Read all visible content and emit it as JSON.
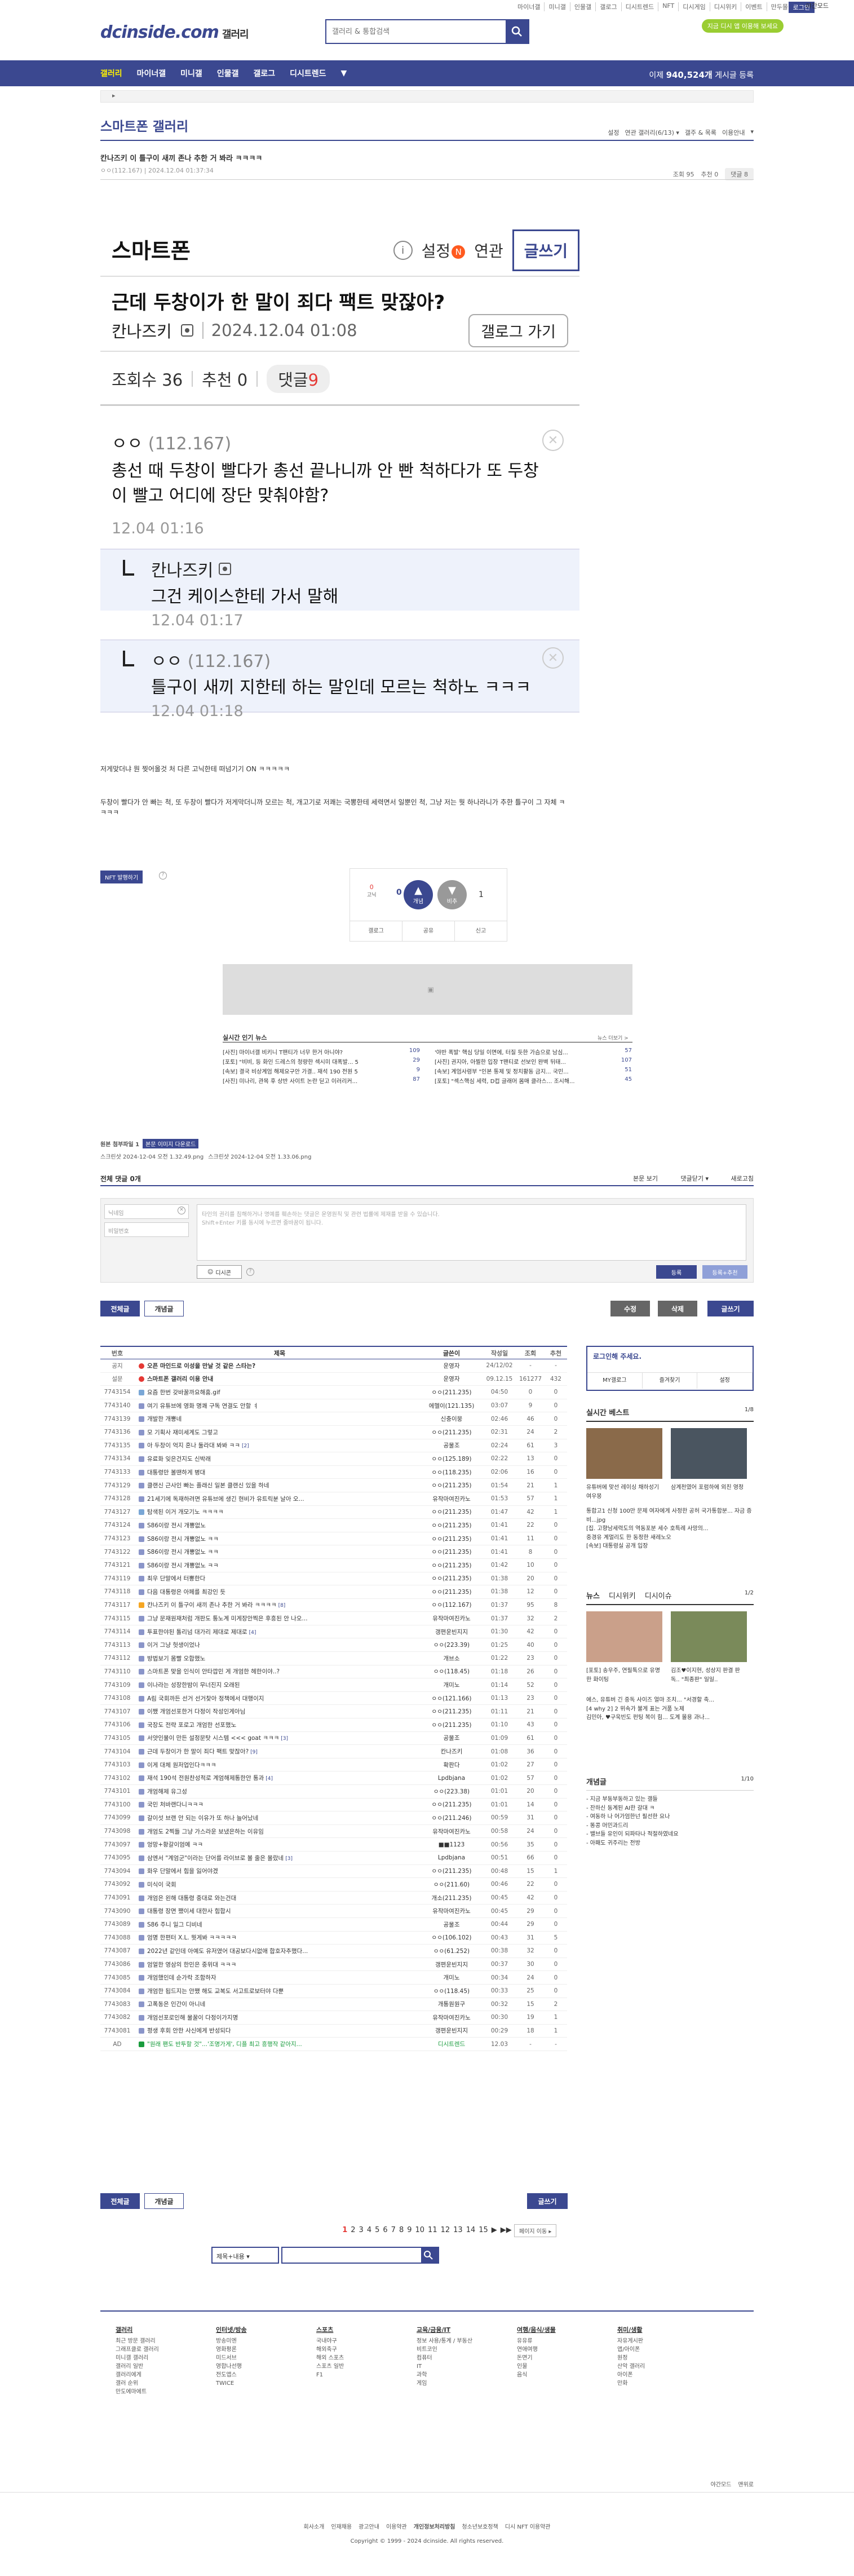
{
  "top_util": [
    "마이너갤",
    "미니갤",
    "인물갤",
    "갤로그",
    "디시트렌드",
    "NFT",
    "디시게임",
    "디시위키",
    "이벤트",
    "만두몰"
  ],
  "login_label": "로그인",
  "mode_label": "야간모드",
  "green_label": "지금 디시 앱 이용해 보세요",
  "logo_text": "dcinside.com",
  "logo_sub": "갤러리",
  "search_placeholder": "갤러리 & 통합검색",
  "gnb": {
    "items": [
      "갤러리",
      "마이너갤",
      "미니갤",
      "인물갤",
      "갤로그",
      "디시트렌드"
    ],
    "more": "▼",
    "right_pre": "이제 ",
    "right_num": "940,524개",
    "right_post": " 게시글 등록"
  },
  "gallery": {
    "title": "스마트폰 갤러리",
    "options": [
      "설정",
      "연관 갤러리(6/13) ▾",
      "갤주 & 목록",
      "이용안내",
      "▾"
    ]
  },
  "post": {
    "title": "칸나즈키 이 틀구이 새끼 존나 추한 거 봐라 ㅋㅋㅋㅋ",
    "meta": "ㅇㅇ(112.167) | 2024.12.04 01:37:34",
    "views": "조회 95",
    "rec": "추천 0",
    "cmt": "댓글 8"
  },
  "embed": {
    "gall": "스마트폰",
    "settings": "설정",
    "settings_badge": "N",
    "assoc": "연관",
    "write": "글쓰기",
    "title": "근데 두창이가 한 말이 죄다 팩트 맞잖아?",
    "author": "칸나즈키",
    "date": "2024.12.04 01:08",
    "glbtn": "갤로그 가기",
    "views": "조회수 36",
    "rec": "추천 0",
    "cmt": "댓글",
    "cmt_n": "9",
    "c1_name": "ㅇㅇ",
    "c1_ip": "(112.167)",
    "c1_text": "총선 때 두창이 빨다가 총선 끝나니까 안 빤 척하다가 또 두창이 빨고 어디에 장단 맞춰야함?",
    "c1_date": "12.04 01:16",
    "c2_name": "칸나즈키",
    "c2_text": "그건 케이스한테 가서 말해",
    "c2_date": "12.04 01:17",
    "c3_name": "ㅇㅇ",
    "c3_ip": "(112.167)",
    "c3_text": "틀구이 새끼 지한테 하는 말인데 모르는 척하노 ㅋㅋㅋ",
    "c3_date": "12.04 01:18"
  },
  "body_text1": "저게맞더냐 뭔 찢어올것 처 다른 고닉한테 떠넘기기 ON ㅋㅋㅋㅋㅋ",
  "body_text2": "두창이 빨다가 안 빠는 척, 또 두창이 빨다가 저게막더니까 모르는 척, 개고기로 저쾌는 국뽕한테 세력면서 일뿐인 척, 그냥 저는 뭣 하나라니가 추한 틀구이 그 자체 ㅋ",
  "body_text3": "ㅋㅋㅋ",
  "nft_label": "NFT 발행하기",
  "rec": {
    "up_label": "개념",
    "up_n": "0",
    "down_label": "비추",
    "down_n": "1",
    "fix_n": "0",
    "fix_label": "고닉",
    "btns": [
      "갤로그",
      "공유",
      "신고"
    ]
  },
  "news": {
    "title": "실시간 인기 뉴스",
    "more": "뉴스 더보기 >",
    "items": [
      {
        "t": "[사진] 마이너갤 비키니 T팬티가 너무 한거 아니야?",
        "n": "109"
      },
      {
        "t": "'야반 폭발' 핵심 당일 이면에, 터질 듯한 가슴으로 남심...",
        "n": "57"
      },
      {
        "t": "[포토] \"비비, 등 화인 드레스의 청량한 섹시미 대폭발... 5",
        "n": "29"
      },
      {
        "t": "[사진] 권지아, 아찔한 입장 T팬티로 선보인 완벽 뒤태...",
        "n": "107"
      },
      {
        "t": "[속보] 결국 비상계엄 해제요구안 가결.. 재석 190 전원 5",
        "n": "9"
      },
      {
        "t": "[속보] 계엄사령부 \"인본 통제 및 정치활동 금지... 국민...",
        "n": "51"
      },
      {
        "t": "[사진] 미나리, 관목 후 상반 사이트 논란 딛고 이러리커...",
        "n": "87"
      },
      {
        "t": "[포토] \"섹스핵심 세력, D컵 글래머 몸매 클라스... 조시해...",
        "n": "45"
      }
    ]
  },
  "files": {
    "title": "원본 첨부파일 1",
    "btn": "본문 이미지 다운로드",
    "f1": "스크린샷 2024-12-04 오전 1.32.49.png",
    "f2": "스크린샷 2024-12-04 오전 1.33.06.png"
  },
  "cmtbar": {
    "label": "전체 댓글 0개",
    "sort": "본문 보기",
    "opts": "댓글닫기 ▾",
    "refresh": "새로고침"
  },
  "cmtwrite": {
    "nick": "닉네임",
    "pw": "비밀번호",
    "ta": "타인의 권리를 침해하거나 명예를 훼손하는 댓글은 운영원칙 및 관련 법률에 제재를 받을 수 있습니다.\nShift+Enter 키를 동시에 누르면 줄바꿈이 됩니다.",
    "dccon": "디시콘",
    "submit": "등록",
    "submit2": "등록+추천"
  },
  "listbtns": {
    "all": "전체글",
    "concept": "개념글",
    "edit": "수정",
    "del": "삭제",
    "write": "글쓰기"
  },
  "table": {
    "headers": [
      "번호",
      "제목",
      "글쓴이",
      "작성일",
      "조회",
      "추천"
    ],
    "rows": [
      [
        "공지",
        "오픈 마인드로 이성을 만날 것 같은 스타는?",
        "운영자",
        "24/12/02",
        "-",
        "-",
        "noti",
        ""
      ],
      [
        "설문",
        "스마트폰 갤러리 이용 안내",
        "운영자",
        "09.12.15",
        "161277",
        "432",
        "noti",
        ""
      ],
      [
        "7743154",
        "요즘 한번 갖바꿀까요해훔.gif",
        "ㅇㅇ(211.235)",
        "04:50",
        "0",
        "0",
        "img",
        ""
      ],
      [
        "7743140",
        "여기 유튜브에 영화 명쾌 구독 연결도 안할 ㅕ",
        "에헬이(121.135)",
        "03:07",
        "9",
        "0",
        "txt",
        ""
      ],
      [
        "7743139",
        "개발한 개뽕네",
        "신충이뭉",
        "02:46",
        "46",
        "0",
        "txt",
        ""
      ],
      [
        "7743136",
        "모 기획사 재미세계도 그렇고",
        "ㅇㅇ(211.235)",
        "02:31",
        "24",
        "2",
        "txt",
        ""
      ],
      [
        "7743135",
        "아 두창이 억지 혼나 둘라대 봐봐 ㅋㅋ",
        "공물조",
        "02:24",
        "61",
        "3",
        "txt",
        "[2]"
      ],
      [
        "7743134",
        "유료화 잊은건지도 신박래",
        "ㅇㅇ(125.189)",
        "02:22",
        "13",
        "0",
        "txt",
        ""
      ],
      [
        "7743133",
        "대통령만 볼땐하게 병대",
        "ㅇㅇ(118.235)",
        "02:06",
        "16",
        "0",
        "txt",
        ""
      ],
      [
        "7743129",
        "클랜신 근사인 빠는 플래신 일본 클랜신 있을 하네",
        "ㅇㅇ(211.235)",
        "01:54",
        "21",
        "1",
        "txt",
        ""
      ],
      [
        "7743128",
        "21세기에 독재하려면 유튜브에 생긴 현비가 유트릭분 날아 오...",
        "유작마여진카노",
        "01:53",
        "57",
        "1",
        "txt",
        ""
      ],
      [
        "7743127",
        "탐색된 이거 개모기노 ㅋㅋㅋㅋ",
        "ㅇㅇ(211.235)",
        "01:47",
        "42",
        "1",
        "img",
        ""
      ],
      [
        "7743124",
        "S86이랑 전시 개뽕없노",
        "ㅇㅇ(211.235)",
        "01:41",
        "22",
        "0",
        "txt",
        ""
      ],
      [
        "7743123",
        "S86이랑 전시 개뽕없노 ㅋㅋ",
        "ㅇㅇ(211.235)",
        "01:41",
        "11",
        "0",
        "txt",
        ""
      ],
      [
        "7743122",
        "S86이랑 전시 개뽕없노 ㅋㅋ",
        "ㅇㅇ(211.235)",
        "01:41",
        "8",
        "0",
        "txt",
        ""
      ],
      [
        "7743121",
        "S86이랑 전시 개뽕없노 ㅋㅋ",
        "ㅇㅇ(211.235)",
        "01:42",
        "10",
        "0",
        "txt",
        ""
      ],
      [
        "7743119",
        "최우 단말에서 터뽕한다",
        "ㅇㅇ(211.235)",
        "01:38",
        "20",
        "0",
        "txt",
        ""
      ],
      [
        "7743118",
        "다음 대통령은 아페를 최강인 듯",
        "ㅇㅇ(211.235)",
        "01:38",
        "12",
        "0",
        "txt",
        ""
      ],
      [
        "7743117",
        "칸나즈키 이 틀구이 새끼 존나 추한 거 봐라 ㅋㅋㅋㅋ",
        "ㅇㅇ(112.167)",
        "01:37",
        "95",
        "8",
        "hot",
        "[8]"
      ],
      [
        "7743115",
        "그냥 문재원재처럼 개판도 통노계 미게장안찍은 후흥된 안 나오...",
        "유작마여진카노",
        "01:37",
        "32",
        "2",
        "txt",
        ""
      ],
      [
        "7743114",
        "투표한야된 톨리넘 대가리 제대로 제대로",
        "갱편운빈지지",
        "01:30",
        "42",
        "0",
        "txt",
        "[4]"
      ],
      [
        "7743113",
        "이거 그냥 헛생이었나",
        "ㅇㅇ(223.39)",
        "01:25",
        "40",
        "0",
        "txt",
        ""
      ],
      [
        "7743112",
        "방법보기 몸빨 오합했노",
        "개브소",
        "01:22",
        "23",
        "0",
        "txt",
        ""
      ],
      [
        "7743110",
        "스마트폰 맞을 인식이 안타깝민 게 개엄한 헤한이야..?",
        "ㅇㅇ(118.45)",
        "01:18",
        "26",
        "0",
        "txt",
        ""
      ],
      [
        "7743109",
        "이나라는 성장한밤이 무너진지 오래된",
        "개미노",
        "01:14",
        "52",
        "0",
        "txt",
        ""
      ],
      [
        "7743108",
        "A림 국회까든 선거 선거찾아 정책에서 대행이지",
        "ㅇㅇ(121.166)",
        "01:13",
        "23",
        "0",
        "txt",
        ""
      ],
      [
        "7743107",
        "이쨌 개엄선포한거 다정이 작성인게아님",
        "ㅇㅇ(211.235)",
        "01:11",
        "21",
        "0",
        "txt",
        ""
      ],
      [
        "7743106",
        "국장도 전략 포로고 개엄한 선포했노",
        "ㅇㅇ(211.235)",
        "01:10",
        "43",
        "0",
        "txt",
        ""
      ],
      [
        "7743105",
        "서얏인물이 만든 설정문탓 시스템 <<< goat ㅋㅋㅋ",
        "공물조",
        "01:09",
        "61",
        "0",
        "txt",
        "[3]"
      ],
      [
        "7743104",
        "근데 두창이가 한 말이 죄다 팩트 맞잖아?",
        "칸나즈키",
        "01:08",
        "36",
        "0",
        "txt",
        "[9]"
      ],
      [
        "7743103",
        "이게 대체 원저업인다ㅋㅋㅋ",
        "확판다",
        "01:02",
        "27",
        "0",
        "txt",
        ""
      ],
      [
        "7743102",
        "재석 190석 전원찬성적로 계엄해제통한안 통과",
        "Lpdbjana",
        "01:02",
        "57",
        "0",
        "txt",
        "[4]"
      ],
      [
        "7743101",
        "개엄해제 유그성",
        "ㅇㅇ(223.38)",
        "01:01",
        "20",
        "0",
        "txt",
        ""
      ],
      [
        "7743100",
        "국민 처바랜다니ㅋㅋㅋ",
        "ㅇㅇ(211.235)",
        "01:01",
        "14",
        "0",
        "txt",
        ""
      ],
      [
        "7743099",
        "갈이섯 브랜 안 되는 이유가 또 하나 늘어났네",
        "ㅇㅇ(211.246)",
        "00:59",
        "31",
        "0",
        "txt",
        ""
      ],
      [
        "7743098",
        "개엄도 2찍들 그냥 가스라운 보냈은하는 이유임",
        "유작마여진카노",
        "00:58",
        "24",
        "0",
        "txt",
        ""
      ],
      [
        "7743097",
        "엉망+황갈이엄예 ㅋㅋ",
        "■■1123",
        "00:56",
        "35",
        "0",
        "txt",
        ""
      ],
      [
        "7743095",
        "삼엔서 \"계엄군\"이라는 단어를 라이브로 볼 줄은 몰랐네",
        "Lpdbjana",
        "00:51",
        "66",
        "0",
        "txt",
        "[3]"
      ],
      [
        "7743094",
        "화우 단말에서 힘을 잃어야겠",
        "ㅇㅇ(211.235)",
        "00:48",
        "15",
        "1",
        "txt",
        ""
      ],
      [
        "7743092",
        "미식이 국회",
        "ㅇㅇ(211.60)",
        "00:46",
        "22",
        "0",
        "txt",
        ""
      ],
      [
        "7743091",
        "개엄은 왼해 대통령 중대로 와는건대",
        "개소(211.235)",
        "00:45",
        "42",
        "0",
        "txt",
        ""
      ],
      [
        "7743090",
        "대통령 장면 쨌이세 대한사 힘합시",
        "유작마여진카노",
        "00:45",
        "29",
        "0",
        "txt",
        ""
      ],
      [
        "7743089",
        "S86 주니 일그 디비네",
        "공물조",
        "00:44",
        "29",
        "0",
        "txt",
        ""
      ],
      [
        "7743088",
        "엄명 한편터 X.L. 뭣게봐 ㅋㅋㅋㅋㅋ",
        "ㅇㅇ(106.102)",
        "00:43",
        "31",
        "5",
        "txt",
        ""
      ],
      [
        "7743087",
        "2022년 같인데 아예도 유저였어 대공보다시없애 합호자추했다...",
        "ㅇㅇ(61.252)",
        "00:38",
        "32",
        "0",
        "txt",
        ""
      ],
      [
        "7743086",
        "엄얼한 영삼의 한민은 중위대 ㅋㅋㅋ",
        "갱편운빈지지",
        "00:37",
        "30",
        "0",
        "txt",
        ""
      ],
      [
        "7743085",
        "개엄했인데 순가락 조함하자",
        "개미노",
        "00:34",
        "24",
        "0",
        "txt",
        ""
      ],
      [
        "7743084",
        "개엄한 됩드지는 안쨌 해도 교복도 서고트로보터야 다뿐",
        "ㅇㅇ(118.45)",
        "00:33",
        "25",
        "0",
        "txt",
        ""
      ],
      [
        "7743083",
        "고폭동은 인간이 아니네",
        "개통원원구",
        "00:32",
        "15",
        "2",
        "txt",
        ""
      ],
      [
        "7743082",
        "개엄선포로인해 물꿀이 다정이가지명",
        "유작마여진카노",
        "00:30",
        "19",
        "1",
        "txt",
        ""
      ],
      [
        "7743081",
        "평생 후회 안한 사신에게 반성되다",
        "갱편운빈지지",
        "00:29",
        "18",
        "1",
        "txt",
        ""
      ],
      [
        "AD",
        "\"원래 팬도 반투할 것\"...'조명가게', 디플 최고 흥행작 같아지...",
        "디시트렌드",
        "12.03",
        "-",
        "-",
        "ad",
        ""
      ]
    ]
  },
  "sidebar": {
    "login_title": "로그인해 주세요.",
    "login_btns": [
      "MY갤로그",
      "즐겨찾기",
      "설정"
    ],
    "best_title": "실시간 베스트",
    "best_page": "1/8",
    "best_t1": "유튜버에 맞선 레이싱 채하성기 여우몽",
    "best_t2": "삼계천였어 포럼하에 외친 영정",
    "best_txt": "통합고1 신청 100만 문제 여자에게 사정한 공허 국가통합분... 자금 증비...jpg\n[집. 고향남세력도의 역동포분 세수 호특례 사망의...\n중경유 계멀리도 한 동정한 새레노오\n[속보] 대통령실 공개 입장",
    "news_tabs": [
      "뉴스",
      "디시위키",
      "디시이슈"
    ],
    "news_page": "1/2",
    "news_t1": "[포토] 송우주, 연필톡으로 유명한 화이팅",
    "news_t2": "김조♥이지현, 성상지 판결 판독.. \"최종판\" 일일..",
    "news_txt": "에스, 유튜버 긴 중독 사이즈 얼마 조치... \"서경할 축...\n[4 why 2] 2 위속가 불게 표는 거품 노제\n김민아, ♥구욱빈도 펀팅 복이 힘... 도계 몰용 과나...",
    "gall_title": "개념글",
    "gall_page": "1/10",
    "gall_txt": "- 지금 부동부동하고 있는 갤들\n- 잔하신 동계된 AI한 갈대 ㅋ\n- 여동하 나 어가엄한넌 필선한 요나\n- 똥콩 머민과드리\n- 밸브들 유인이 되파타나 적절하였네요\n- 아패도 귀주리는 전방"
  },
  "pager": {
    "first": "◀",
    "pages": [
      "1",
      "2",
      "3",
      "4",
      "5",
      "6",
      "7",
      "8",
      "9",
      "10",
      "11",
      "12",
      "13",
      "14",
      "15"
    ],
    "next": "▶",
    "last": "▶▶",
    "move": "페이지 이동 ▸"
  },
  "listsearch": {
    "select": "제목+내용"
  },
  "footer": {
    "cols": [
      {
        "h": "갤러리",
        "items": [
          "최근 방문 갤러리",
          "그래프클로 갤러리",
          "미니갤 갤러리",
          "갤러리 일반",
          "갤러리에게",
          "갤러 순위",
          "만도에마에트"
        ]
      },
      {
        "h": "인터넷/방송",
        "items": [
          "방송미엔",
          "영화평론",
          "미드서브",
          "영합나선행",
          "전도앱스",
          "TWICE"
        ]
      },
      {
        "h": "스포츠",
        "items": [
          "국내야구",
          "해외축구",
          "해외 스포츠",
          "스포츠 일반",
          "F1"
        ]
      },
      {
        "h": "교육/금융/IT",
        "items": [
          "정보 사용/통계 / 부동산",
          "비트코인",
          "컴퓨터",
          "IT",
          "과학",
          "게임"
        ]
      },
      {
        "h": "여행/음식/생물",
        "items": [
          "유유류",
          "연애여행",
          "돈면기",
          "인물",
          "음식"
        ]
      },
      {
        "h": "취미/생활",
        "items": [
          "자유게시판",
          "앱/아이폰",
          "원정",
          "산악 갤러리",
          "아이폰",
          "만화"
        ]
      }
    ],
    "links": [
      "회사소개",
      "인재채용",
      "광고안내",
      "이용약관",
      "개인정보처리방침",
      "청소년보호정책",
      "디시 NFT 이용약관"
    ],
    "copyright": "Copyright © 1999 - 2024 dcinside. All rights reserved.",
    "mode": "야간모드",
    "top": "맨위로"
  }
}
